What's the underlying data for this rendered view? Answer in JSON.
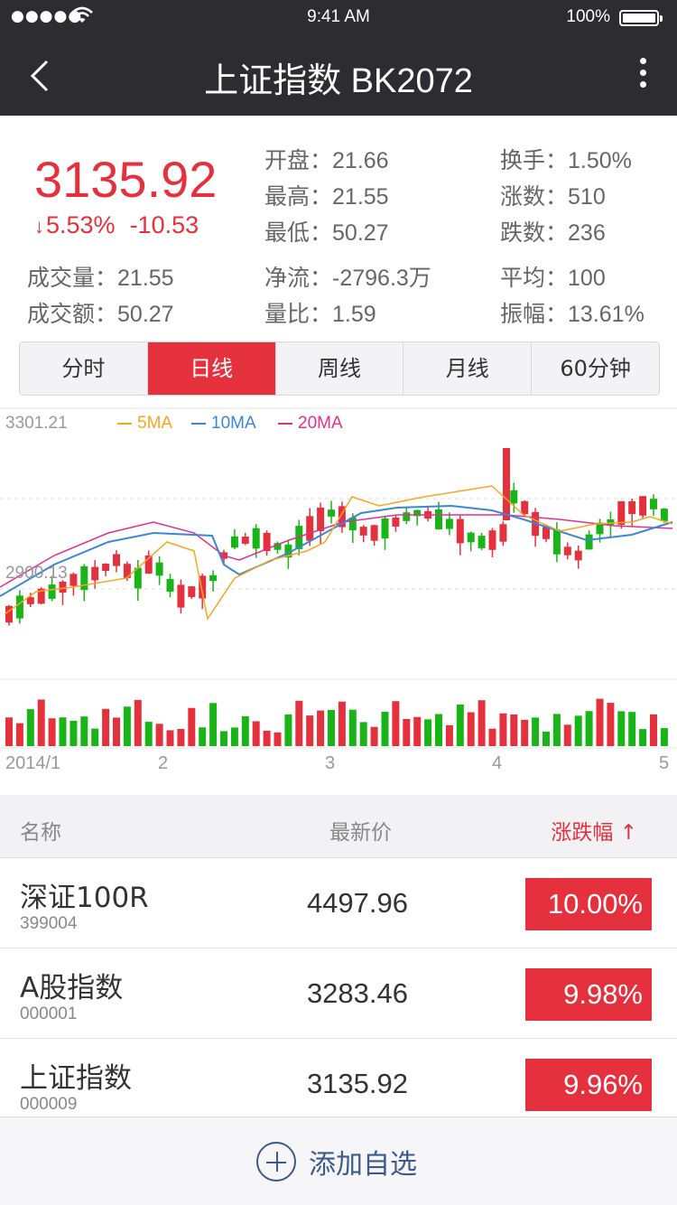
{
  "status_bar": {
    "signal": "●●●●●",
    "time": "9:41 AM",
    "battery": "100%"
  },
  "nav": {
    "title": "上证指数 BK2072"
  },
  "quote": {
    "price": "3135.92",
    "change_pct": "5.53%",
    "change_abs": "-10.53",
    "stats": {
      "open": {
        "label": "开盘：",
        "value": "21.66"
      },
      "high": {
        "label": "最高：",
        "value": "21.55"
      },
      "low": {
        "label": "最低：",
        "value": "50.27"
      },
      "turnover_rate": {
        "label": "换手：",
        "value": "1.50%"
      },
      "up_count": {
        "label": "涨数：",
        "value": "510"
      },
      "down_count": {
        "label": "跌数：",
        "value": "236"
      },
      "volume": {
        "label": "成交量：",
        "value": "21.55"
      },
      "amount": {
        "label": "成交额：",
        "value": "50.27"
      },
      "net_flow": {
        "label": "净流：",
        "value": "-2796.3万"
      },
      "volume_ratio": {
        "label": "量比：",
        "value": "1.59"
      },
      "average": {
        "label": "平均：",
        "value": "100"
      },
      "amplitude": {
        "label": "振幅：",
        "value": "13.61%"
      }
    }
  },
  "tabs": [
    {
      "label": "分时",
      "active": false
    },
    {
      "label": "日线",
      "active": true
    },
    {
      "label": "周线",
      "active": false
    },
    {
      "label": "月线",
      "active": false
    },
    {
      "label": "60分钟",
      "active": false
    }
  ],
  "chart": {
    "max_label": "3301.21",
    "mid_label": "2900.13",
    "legend": [
      {
        "name": "5MA",
        "color": "#f5a623"
      },
      {
        "name": "10MA",
        "color": "#3b86d6"
      },
      {
        "name": "20MA",
        "color": "#e0308f"
      }
    ],
    "date_ticks": [
      "2014/1",
      "2",
      "3",
      "4",
      "5"
    ],
    "up_color": "#e5313d",
    "down_color": "#18b418"
  },
  "chart_data": {
    "type": "candlestick",
    "y_range_top": 3301.21,
    "y_marked": 2900.13,
    "x_ticks": [
      "2014/1",
      "2",
      "3",
      "4",
      "5"
    ],
    "series": [
      {
        "name": "5MA"
      },
      {
        "name": "10MA"
      },
      {
        "name": "20MA"
      }
    ]
  },
  "list": {
    "header": {
      "name": "名称",
      "price": "最新价",
      "change": "涨跌幅"
    },
    "rows": [
      {
        "name": "深证100R",
        "code": "399004",
        "price": "4497.96",
        "change": "10.00%"
      },
      {
        "name": "A股指数",
        "code": "000001",
        "price": "3283.46",
        "change": "9.98%"
      },
      {
        "name": "上证指数",
        "code": "000009",
        "price": "3135.92",
        "change": "9.96%"
      }
    ]
  },
  "bottom": {
    "add_label": "添加自选"
  }
}
